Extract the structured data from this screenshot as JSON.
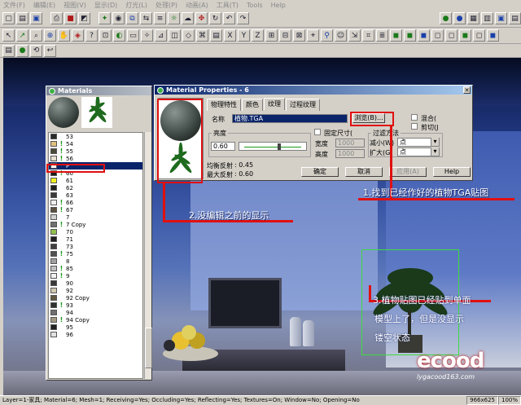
{
  "menu": [
    "文件(F)",
    "编辑(E)",
    "视图(V)",
    "显示(D)",
    "灯光(L)",
    "处理(P)",
    "动画(A)",
    "工具(T)",
    "Tools",
    "Help"
  ],
  "materials_window": {
    "title": "Materials",
    "items": [
      {
        "label": "53",
        "color": "#2a2a2a",
        "flag": ""
      },
      {
        "label": "54",
        "color": "#e0c080",
        "flag": "!"
      },
      {
        "label": "55",
        "color": "#4a4a3a",
        "flag": "!"
      },
      {
        "label": "56",
        "color": "#e8e0d0",
        "flag": "!"
      },
      {
        "label": "P",
        "color": "#ffffff",
        "flag": "",
        "selected": true
      },
      {
        "label": "60",
        "color": "#1a1a1a",
        "flag": "!"
      },
      {
        "label": "61",
        "color": "#f0f020",
        "flag": ""
      },
      {
        "label": "62",
        "color": "#202020",
        "flag": ""
      },
      {
        "label": "63",
        "color": "#3a3a3a",
        "flag": ""
      },
      {
        "label": "66",
        "color": "#f0f0f0",
        "flag": "!"
      },
      {
        "label": "67",
        "color": "#5a5040",
        "flag": "!"
      },
      {
        "label": "7",
        "color": "#d0d0d0",
        "flag": ""
      },
      {
        "label": "7 Copy",
        "color": "#707070",
        "flag": "!"
      },
      {
        "label": "70",
        "color": "#90c050",
        "flag": ""
      },
      {
        "label": "71",
        "color": "#202020",
        "flag": ""
      },
      {
        "label": "73",
        "color": "#404040",
        "flag": ""
      },
      {
        "label": "75",
        "color": "#505050",
        "flag": "!"
      },
      {
        "label": "8",
        "color": "#a0a0a0",
        "flag": ""
      },
      {
        "label": "85",
        "color": "#c0c0c0",
        "flag": "!"
      },
      {
        "label": "9",
        "color": "#f0f0f0",
        "flag": "!"
      },
      {
        "label": "90",
        "color": "#383838",
        "flag": ""
      },
      {
        "label": "92",
        "color": "#d0c8b0",
        "flag": ""
      },
      {
        "label": "92 Copy",
        "color": "#605840",
        "flag": ""
      },
      {
        "label": "93",
        "color": "#303030",
        "flag": "!"
      },
      {
        "label": "94",
        "color": "#707070",
        "flag": ""
      },
      {
        "label": "94 Copy",
        "color": "#a09880",
        "flag": "!"
      },
      {
        "label": "95",
        "color": "#202020",
        "flag": ""
      },
      {
        "label": "96",
        "color": "#e0e0e0",
        "flag": ""
      }
    ]
  },
  "material_properties": {
    "title": "Material Properties - 6",
    "tabs": [
      "物理特性",
      "颜色",
      "纹理",
      "过程纹理"
    ],
    "active_tab": "纹理",
    "name_label": "名称",
    "name_value": "植物.TGA",
    "browse_button": "浏览(B)...",
    "blend_label": "混合(",
    "clip_label": "剪切(J",
    "brightness_label": "亮度",
    "brightness_value": "0.60",
    "brightness_level": 0.6,
    "fixed_size_label": "固定尺寸(",
    "width_label": "宽度",
    "width_value": "1000",
    "height_label": "高度",
    "height_value": "1000",
    "filter_label": "过滤方法",
    "shrink_label": "减小(W)",
    "shrink_value": "点",
    "enlarge_label": "扩大(G)",
    "enlarge_value": "点",
    "avg_reflect_label": "均衡反射",
    "avg_reflect_value": ": 0.45",
    "max_reflect_label": "最大反射",
    "max_reflect_value": ": 0.60",
    "ok_button": "确定",
    "cancel_button": "取消",
    "apply_button": "应用(A)",
    "help_button": "Help"
  },
  "annotations": {
    "a1": "1.找到已经作好的植物TGA贴图",
    "a2": "2.没编辑之前的显示",
    "a3_line1": "3.植物贴图已经贴到单面",
    "a3_line2": "模型上了，但是没显示",
    "a3_line3": "镂空状态"
  },
  "logo": {
    "big": "ecood",
    "small": "lygacood163.com"
  },
  "status": {
    "text": "Layer=1-家具; Material=6; Mesh=1; Receiving=Yes; Occluding=Yes; Reflecting=Yes; Textures=On; Window=No; Opening=No",
    "resolution": "966x625",
    "zoom": "100%"
  },
  "colors": {
    "annotation_red": "#e01010",
    "plant_box_green": "#3ddc3d",
    "selection_blue": "#0a246a"
  }
}
